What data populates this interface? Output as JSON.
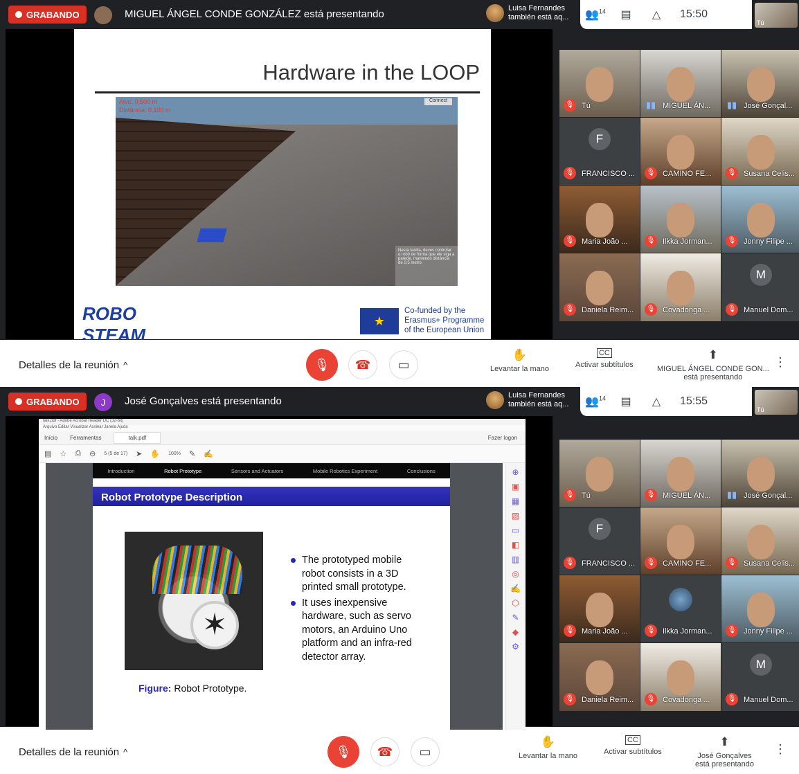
{
  "top": {
    "recording_label": "GRABANDO",
    "p1_presenter_initial": "",
    "p1_presenter_text": "MIGUEL ÁNGEL CONDE GONZÁLEZ está presentando",
    "p2_presenter_initial": "J",
    "p2_presenter_text": "José Gonçalves está presentando",
    "luisa_line1": "Luisa Fernandes",
    "luisa_line2": "también está aq...",
    "people_count": "14",
    "time1": "15:50",
    "time2": "15:55",
    "self_label": "Tú"
  },
  "slide1": {
    "title": "Hardware in the LOOP",
    "sim_alt": "Alvo: 0,500 m",
    "sim_dist": "Distância: 0,100 m",
    "sim_connect": "Connect",
    "sim_tip": "Nesta tarefa, deves controlar o robô de forma que ele siga a parede, mantendo distância de 0,5 metro.",
    "logo_robo": "ROBO",
    "logo_steam": "STEAM",
    "eu_line1": "Co-funded by the",
    "eu_line2": "Erasmus+ Programme",
    "eu_line3": "of the European Union"
  },
  "slide2": {
    "window_title": "talk.pdf - Adobe Acrobat Reader DC (32-bit)",
    "menu": "Arquivo  Editar  Visualizar  Assinar  Janela  Ajuda",
    "tab_home": "Início",
    "tab_tools": "Ferramentas",
    "tab_doc": "talk.pdf",
    "logon": "Fazer logon",
    "page_info": "5 (5 de 17)",
    "zoom": "100%",
    "nav": [
      "Introduction",
      "Robot Prototype",
      "Sensors and Actuators",
      "Mobile Robotics Experiment",
      "Conclusions"
    ],
    "heading": "Robot Prototype Description",
    "figure_label": "Figure:",
    "figure_text": "Robot Prototype.",
    "bullet1": "The prototyped mobile robot consists in a 3D printed small prototype.",
    "bullet2": "It uses inexpensive hardware, such as servo motors, an Arduino Uno platform and an infra-red detector array."
  },
  "participants": [
    {
      "name": "Tú",
      "initial": ""
    },
    {
      "name": "MIGUEL ÁN...",
      "initial": ""
    },
    {
      "name": "José Gonçal...",
      "initial": ""
    },
    {
      "name": "FRANCISCO ...",
      "initial": "F"
    },
    {
      "name": "CAMINO FE...",
      "initial": ""
    },
    {
      "name": "Susana Celis...",
      "initial": ""
    },
    {
      "name": "Maria João ...",
      "initial": ""
    },
    {
      "name": "Ilkka Jorman...",
      "initial": ""
    },
    {
      "name": "Jonny Filipe ...",
      "initial": ""
    },
    {
      "name": "Daniela Reim...",
      "initial": ""
    },
    {
      "name": "Covadonga ...",
      "initial": ""
    },
    {
      "name": "Manuel Dom...",
      "initial": "M"
    }
  ],
  "controls": {
    "details": "Detalles de la reunión",
    "raise_hand": "Levantar la mano",
    "captions": "Activar subtítulos",
    "cc_icon": "CC",
    "present1_line1": "MIGUEL ÁNGEL CONDE GON...",
    "present1_line2": "está presentando",
    "present2_line1": "José Gonçalves",
    "present2_line2": "está presentando"
  },
  "colors": {
    "record": "#d93025",
    "mic_off": "#ea4335",
    "slide_heading": "#2020a0"
  }
}
